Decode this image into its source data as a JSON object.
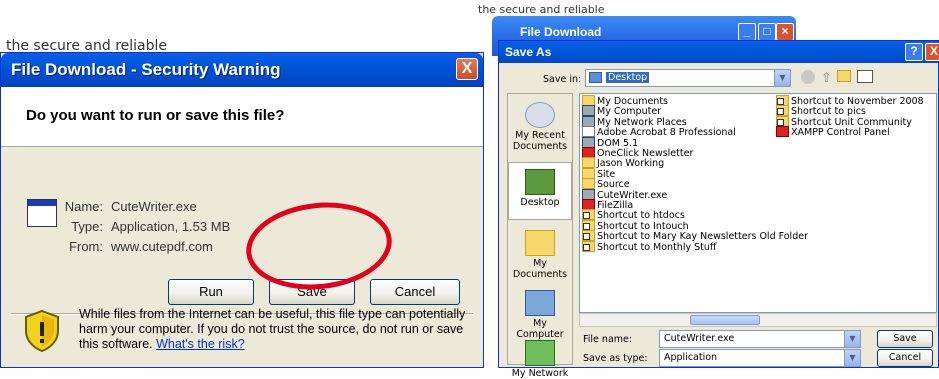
{
  "background": {
    "top_snippet": "the secure and reliable",
    "mid_snippet": "the secure and reliable"
  },
  "security_dialog": {
    "title": "File Download - Security Warning",
    "close_glyph": "X",
    "question": "Do you want to run or save this file?",
    "name_label": "Name:",
    "name_value": "CuteWriter.exe",
    "type_label": "Type:",
    "type_value": "Application, 1.53 MB",
    "from_label": "From:",
    "from_value": "www.cutepdf.com",
    "run_label": "Run",
    "save_label": "Save",
    "cancel_label": "Cancel",
    "warning_text": "While files from the Internet can be useful, this file type can potentially harm your computer. If you do not trust the source, do not run or save this software.",
    "risk_link": "What's the risk?"
  },
  "file_download_window": {
    "title": "File Download"
  },
  "save_as": {
    "title": "Save As",
    "help_glyph": "?",
    "close_glyph": "X",
    "save_in_label": "Save in:",
    "save_in_value": "Desktop",
    "places": [
      {
        "label": "My Recent Documents"
      },
      {
        "label": "Desktop"
      },
      {
        "label": "My Documents"
      },
      {
        "label": "My Computer"
      },
      {
        "label": "My Network"
      }
    ],
    "files_col1": [
      {
        "name": "My Documents",
        "kind": "folder"
      },
      {
        "name": "My Computer",
        "kind": "app"
      },
      {
        "name": "My Network Places",
        "kind": "app"
      },
      {
        "name": "Adobe Acrobat 8 Professional",
        "kind": "doc"
      },
      {
        "name": "DOM 5.1",
        "kind": "app"
      },
      {
        "name": "OneClick Newsletter",
        "kind": "red"
      },
      {
        "name": "Jason Working",
        "kind": "folder"
      },
      {
        "name": "Site",
        "kind": "folder"
      },
      {
        "name": "Source",
        "kind": "folder"
      },
      {
        "name": "CuteWriter.exe",
        "kind": "app"
      },
      {
        "name": "FileZilla",
        "kind": "red"
      },
      {
        "name": "Shortcut to htdocs",
        "kind": "shortcut"
      },
      {
        "name": "Shortcut to Intouch",
        "kind": "shortcut"
      },
      {
        "name": "Shortcut to Mary Kay Newsletters Old Folder",
        "kind": "shortcut"
      },
      {
        "name": "Shortcut to Monthly Stuff",
        "kind": "shortcut"
      }
    ],
    "files_col2": [
      {
        "name": "Shortcut to November 2008",
        "kind": "shortcut"
      },
      {
        "name": "Shortcut to pics",
        "kind": "shortcut"
      },
      {
        "name": "Shortcut Unit Community",
        "kind": "shortcut"
      },
      {
        "name": "XAMPP Control Panel",
        "kind": "red"
      }
    ],
    "file_name_label": "File name:",
    "file_name_value": "CuteWriter.exe",
    "save_as_type_label": "Save as type:",
    "save_as_type_value": "Application",
    "save_label": "Save",
    "cancel_label": "Cancel"
  }
}
